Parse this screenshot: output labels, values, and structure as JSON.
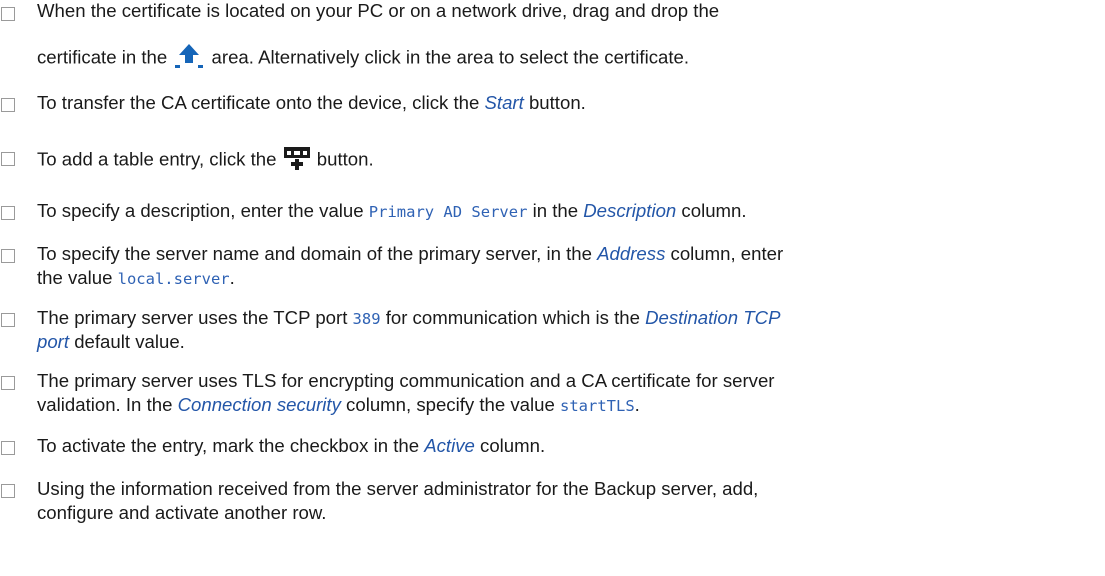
{
  "steps": [
    {
      "l1": "When the certificate is located on your PC or on a network drive, drag and drop the",
      "l2a": "certificate in the ",
      "l2b": " area. Alternatively click in the area to select the certificate.",
      "icon": "upload-icon"
    },
    {
      "a": "To transfer the CA certificate onto the device, click the ",
      "b": "Start",
      "c": " button."
    },
    {
      "a": "To add a table entry, click the ",
      "b": " button.",
      "icon": "add-table-row-icon"
    },
    {
      "a": "To specify a description, enter the value ",
      "b": "Primary AD Server",
      "c": " in the ",
      "d": "Description",
      "e": " column."
    },
    {
      "l1a": "To specify the server name and domain of the primary server, in the ",
      "l1b": "Address",
      "l1c": " column, enter",
      "l2a": "the value ",
      "l2b": "local.server",
      "l2c": "."
    },
    {
      "l1a": "The primary server uses the TCP port ",
      "l1b": "389",
      "l1c": " for communication which is the ",
      "l1d": "Destination TCP",
      "l2a": "port",
      "l2b": " default value."
    },
    {
      "l1": "The primary server uses TLS for encrypting communication and a CA certificate for server",
      "l2a": "validation. In the ",
      "l2b": "Connection security",
      "l2c": " column, specify the value ",
      "l2d": "startTLS",
      "l2e": "."
    },
    {
      "a": "To activate the entry, mark the checkbox in the ",
      "b": "Active",
      "c": " column."
    },
    {
      "l1": "Using the information received from the server administrator for the Backup server, add,",
      "l2": "configure and activate another row."
    }
  ],
  "colors": {
    "link": "#2356a8",
    "code": "#2f62b4",
    "icon": "#1565b8",
    "text": "#1a1a1a"
  }
}
